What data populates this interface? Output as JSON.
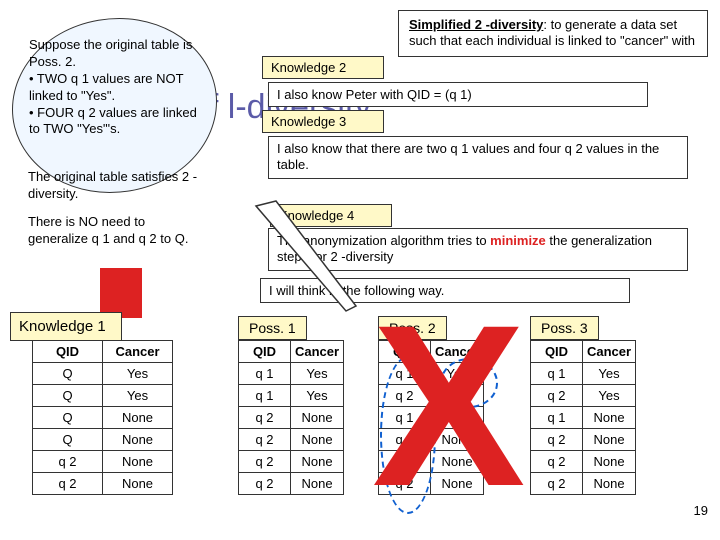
{
  "background_title": "of l-diversity",
  "bubble_left": {
    "l1": "Suppose the original table is Poss. 2.",
    "l2": "• TWO q 1 values are NOT linked to \"Yes\".",
    "l3": "• FOUR q 2 values are linked to TWO \"Yes\"'s."
  },
  "bubble_left2": "The original table satisfies 2 -diversity.",
  "bubble_left3": "There is NO need to generalize q 1 and q 2 to Q.",
  "simplified": {
    "title": "Simplified 2 -diversity",
    "rest": ": to generate a data set such that each individual is linked to \"cancer\" with"
  },
  "knowledge2": {
    "label": "Knowledge 2",
    "sub": "I also know Peter with QID = (q 1)"
  },
  "knowledge3": {
    "label": "Knowledge 3",
    "sub": "I also know that there are two q 1 values and four q 2 values in the table."
  },
  "knowledge4": {
    "label": "Knowledge 4",
    "sub1a": "The anonymization algorithm tries to ",
    "sub1b": "minimize",
    "sub1c": " the generalization steps for 2 -diversity",
    "sub2": "I will think in the following way."
  },
  "knowledge1": {
    "label": "Knowledge 1"
  },
  "poss": {
    "p1": "Poss. 1",
    "p2": "Poss. 2",
    "p3": "Poss. 3"
  },
  "table1": {
    "headers": [
      "QID",
      "Cancer"
    ],
    "rows": [
      [
        "Q",
        "Yes"
      ],
      [
        "Q",
        "Yes"
      ],
      [
        "Q",
        "None"
      ],
      [
        "Q",
        "None"
      ],
      [
        "q 2",
        "None"
      ],
      [
        "q 2",
        "None"
      ]
    ]
  },
  "poss1": {
    "headers": [
      "QID",
      "Cancer"
    ],
    "rows": [
      [
        "q 1",
        "Yes"
      ],
      [
        "q 1",
        "Yes"
      ],
      [
        "q 2",
        "None"
      ],
      [
        "q 2",
        "None"
      ],
      [
        "q 2",
        "None"
      ],
      [
        "q 2",
        "None"
      ]
    ]
  },
  "poss2": {
    "headers": [
      "QID",
      "Cancer"
    ],
    "rows": [
      [
        "q 1",
        "Yes"
      ],
      [
        "q 2",
        "Yes"
      ],
      [
        "q 1",
        "None"
      ],
      [
        "q 2",
        "None"
      ],
      [
        "q 2",
        "None"
      ],
      [
        "q 2",
        "None"
      ]
    ]
  },
  "poss3": {
    "headers": [
      "QID",
      "Cancer"
    ],
    "rows": [
      [
        "q 1",
        "Yes"
      ],
      [
        "q 2",
        "Yes"
      ],
      [
        "q 1",
        "None"
      ],
      [
        "q 2",
        "None"
      ],
      [
        "q 2",
        "None"
      ],
      [
        "q 2",
        "None"
      ]
    ]
  },
  "page_number": "19",
  "chart_data": {
    "type": "table",
    "tables": [
      {
        "name": "Knowledge 1",
        "columns": [
          "QID",
          "Cancer"
        ],
        "rows": [
          [
            "Q",
            "Yes"
          ],
          [
            "Q",
            "Yes"
          ],
          [
            "Q",
            "None"
          ],
          [
            "Q",
            "None"
          ],
          [
            "q 2",
            "None"
          ],
          [
            "q 2",
            "None"
          ]
        ]
      },
      {
        "name": "Poss. 1",
        "columns": [
          "QID",
          "Cancer"
        ],
        "rows": [
          [
            "q 1",
            "Yes"
          ],
          [
            "q 1",
            "Yes"
          ],
          [
            "q 2",
            "None"
          ],
          [
            "q 2",
            "None"
          ],
          [
            "q 2",
            "None"
          ],
          [
            "q 2",
            "None"
          ]
        ]
      },
      {
        "name": "Poss. 2",
        "columns": [
          "QID",
          "Cancer"
        ],
        "rows": [
          [
            "q 1",
            "Yes"
          ],
          [
            "q 2",
            "Yes"
          ],
          [
            "q 1",
            "None"
          ],
          [
            "q 2",
            "None"
          ],
          [
            "q 2",
            "None"
          ],
          [
            "q 2",
            "None"
          ]
        ],
        "crossed_out": true
      },
      {
        "name": "Poss. 3",
        "columns": [
          "QID",
          "Cancer"
        ],
        "rows": [
          [
            "q 1",
            "Yes"
          ],
          [
            "q 2",
            "Yes"
          ],
          [
            "q 1",
            "None"
          ],
          [
            "q 2",
            "None"
          ],
          [
            "q 2",
            "None"
          ],
          [
            "q 2",
            "None"
          ]
        ]
      }
    ]
  }
}
